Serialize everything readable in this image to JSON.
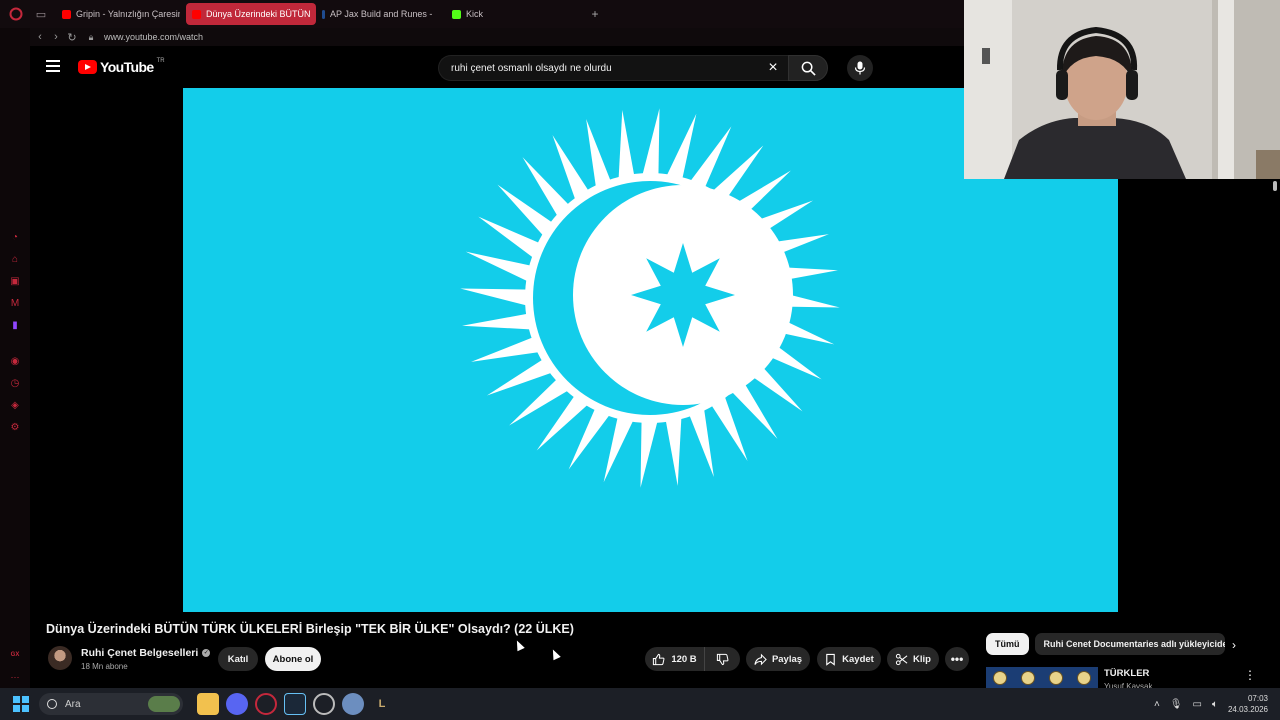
{
  "browser": {
    "tabs": [
      {
        "label": "Gripin - Yalnızlığın Çaresini",
        "favicon": "youtube",
        "active": false
      },
      {
        "label": "Dünya Üzerindeki BÜTÜN",
        "favicon": "youtube",
        "active": true
      },
      {
        "label": "AP Jax Build and Runes -",
        "favicon": "blitz",
        "active": false
      },
      {
        "label": "Kick",
        "favicon": "kick",
        "active": false
      }
    ],
    "new_tab_label": "+",
    "url": "www.youtube.com/watch",
    "sidebar_label": "GX"
  },
  "youtube": {
    "logo_text": "YouTube",
    "region": "TR",
    "search_value": "ruhi çenet osmanlı olsaydı ne olurdu",
    "video": {
      "title": "Dünya Üzerindeki BÜTÜN TÜRK ÜLKELERİ Birleşip \"TEK BİR ÜLKE\" Olsaydı? (22 ÜLKE)",
      "channel": "Ruhi Çenet Belgeselleri",
      "subscribers": "18 Mn abone",
      "join_label": "Katıl",
      "subscribe_label": "Abone ol",
      "likes": "120 B",
      "share_label": "Paylaş",
      "save_label": "Kaydet",
      "clip_label": "Klip",
      "more_label": "•••"
    },
    "chips": [
      {
        "label": "Tümü",
        "active": true
      },
      {
        "label": "Ruhi Cenet Documentaries adlı yükleyiciden",
        "active": false
      }
    ],
    "recommendation": {
      "title": "TÜRKLER",
      "channel": "Yusuf Kavşak"
    }
  },
  "taskbar": {
    "search_placeholder": "Ara",
    "time": "07:03",
    "date": "24.03.2026"
  },
  "colors": {
    "video_background": "#13cdea",
    "active_tab": "#c0283a",
    "opera_accent": "#c4283c",
    "youtube_red": "#ff0000"
  }
}
